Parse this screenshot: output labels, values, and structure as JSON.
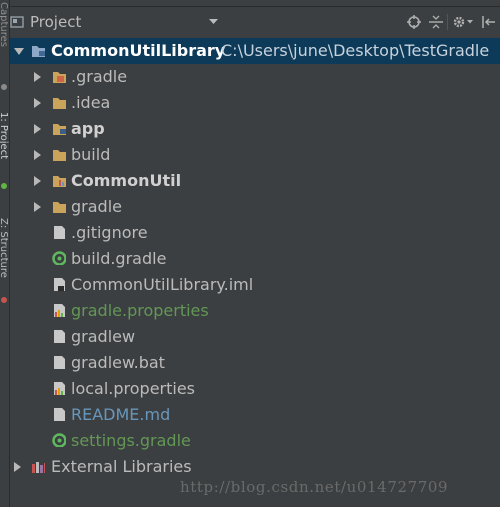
{
  "window": {
    "title": "Project"
  },
  "side_strip": {
    "tabs": [
      "Captures",
      "1: Project",
      "Z: Structure"
    ]
  },
  "header": {
    "view_label": "Project",
    "icons": [
      "sync-icon",
      "collapse-all-icon",
      "gear-icon",
      "hide-icon"
    ]
  },
  "colors": {
    "background": "#3c3f41",
    "selection": "#0d3a58",
    "text": "#bbbbbb",
    "vcs_added": "#629755",
    "vcs_modified": "#6897bb",
    "folder": "#c9a45a"
  },
  "tree": {
    "root": {
      "name": "CommonUtilLibrary",
      "path": "C:\\Users\\june\\Desktop\\TestGradle",
      "expanded": true
    },
    "items": [
      {
        "name": ".gradle",
        "kind": "folder",
        "icon": "folder-excluded-icon"
      },
      {
        "name": ".idea",
        "kind": "folder",
        "icon": "folder-icon"
      },
      {
        "name": "app",
        "kind": "module",
        "icon": "module-folder-icon"
      },
      {
        "name": "build",
        "kind": "folder",
        "icon": "folder-icon"
      },
      {
        "name": "CommonUtil",
        "kind": "module",
        "icon": "module-folder-icon"
      },
      {
        "name": "gradle",
        "kind": "folder",
        "icon": "folder-icon"
      },
      {
        "name": ".gitignore",
        "kind": "file",
        "icon": "text-file-icon"
      },
      {
        "name": "build.gradle",
        "kind": "file",
        "icon": "gradle-file-icon"
      },
      {
        "name": "CommonUtilLibrary.iml",
        "kind": "file",
        "icon": "iml-file-icon"
      },
      {
        "name": "gradle.properties",
        "kind": "file",
        "icon": "properties-file-icon",
        "status": "added"
      },
      {
        "name": "gradlew",
        "kind": "file",
        "icon": "text-file-icon"
      },
      {
        "name": "gradlew.bat",
        "kind": "file",
        "icon": "text-file-icon"
      },
      {
        "name": "local.properties",
        "kind": "file",
        "icon": "properties-file-icon"
      },
      {
        "name": "README.md",
        "kind": "file",
        "icon": "text-file-icon",
        "status": "modified"
      },
      {
        "name": "settings.gradle",
        "kind": "file",
        "icon": "gradle-file-icon",
        "status": "added"
      }
    ],
    "external": {
      "name": "External Libraries",
      "icon": "library-icon"
    }
  },
  "watermark": "http://blog.csdn.net/u014727709"
}
